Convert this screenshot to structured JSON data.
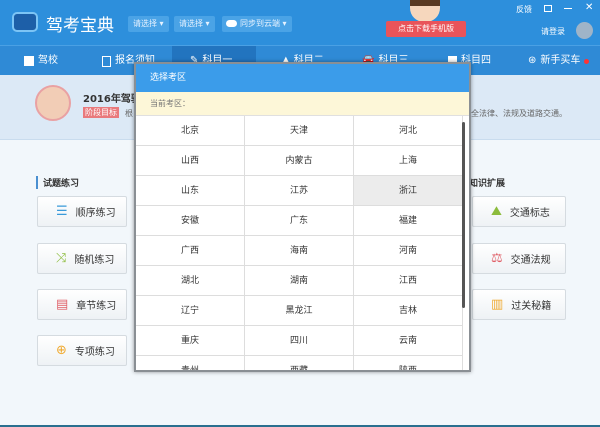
{
  "app": {
    "title": "驾考宝典",
    "dropdown1": "请选择 ▾",
    "dropdown2": "请选择 ▾",
    "sync": "同步到云端 ▾",
    "download": "点击下载手机版",
    "feedback": "反馈",
    "login": "请登录"
  },
  "nav": [
    {
      "label": "驾校"
    },
    {
      "label": "报名须知"
    },
    {
      "label": "科目一"
    },
    {
      "label": "科目二"
    },
    {
      "label": "科目三"
    },
    {
      "label": "科目四"
    },
    {
      "label": "新手买车"
    }
  ],
  "banner": {
    "title": "2016年驾驶",
    "badge": "阶段目标",
    "text": "根",
    "text_right": "全法律、法规及道路交通。"
  },
  "practice": {
    "title": "试题练习",
    "items": [
      {
        "label": "顺序练习"
      },
      {
        "label": "随机练习"
      },
      {
        "label": "章节练习"
      },
      {
        "label": "专项练习"
      }
    ]
  },
  "knowledge": {
    "title": "知识扩展",
    "items": [
      {
        "label": "交通标志"
      },
      {
        "label": "交通法规"
      },
      {
        "label": "过关秘籍"
      }
    ]
  },
  "modal": {
    "title": "选择考区",
    "current": "当前考区：",
    "regions": [
      "北京",
      "天津",
      "河北",
      "山西",
      "内蒙古",
      "上海",
      "山东",
      "江苏",
      "浙江",
      "安徽",
      "广东",
      "福建",
      "广西",
      "海南",
      "河南",
      "湖北",
      "湖南",
      "江西",
      "辽宁",
      "黑龙江",
      "吉林",
      "重庆",
      "四川",
      "云南",
      "贵州",
      "西藏",
      "陕西"
    ],
    "selected": "浙江"
  },
  "colors": {
    "primary": "#2d8fdc",
    "download": "#e9545a",
    "badge": "#e9797c"
  }
}
